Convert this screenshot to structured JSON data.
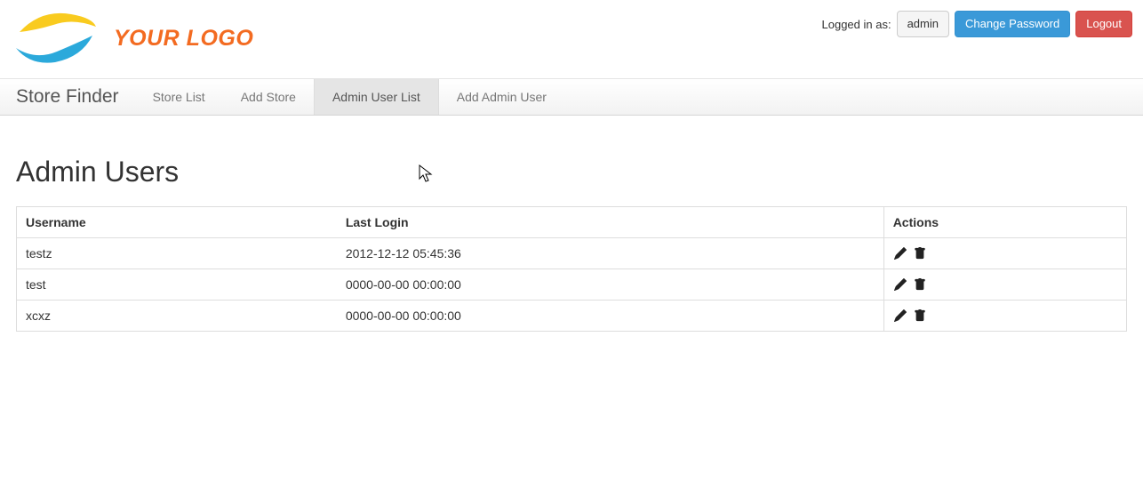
{
  "header": {
    "logo_text": "YOUR LOGO",
    "logged_in_label": "Logged in as:",
    "username": "admin",
    "change_password_label": "Change Password",
    "logout_label": "Logout"
  },
  "navbar": {
    "brand": "Store Finder",
    "items": [
      {
        "label": "Store List",
        "active": false
      },
      {
        "label": "Add Store",
        "active": false
      },
      {
        "label": "Admin User List",
        "active": true
      },
      {
        "label": "Add Admin User",
        "active": false
      }
    ]
  },
  "main": {
    "page_title": "Admin Users",
    "table": {
      "headers": {
        "username": "Username",
        "last_login": "Last Login",
        "actions": "Actions"
      },
      "rows": [
        {
          "username": "testz",
          "last_login": "2012-12-12 05:45:36"
        },
        {
          "username": "test",
          "last_login": "0000-00-00 00:00:00"
        },
        {
          "username": "xcxz",
          "last_login": "0000-00-00 00:00:00"
        }
      ]
    }
  }
}
